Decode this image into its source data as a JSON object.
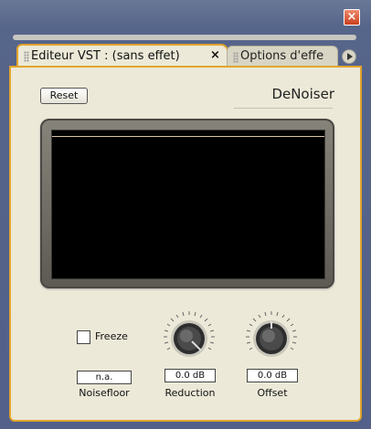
{
  "window": {
    "close_label": "×"
  },
  "tabs": [
    {
      "label": "Editeur VST : (sans effet)",
      "close": "×",
      "active": true
    },
    {
      "label": "Options d'effe",
      "active": false
    }
  ],
  "toolbar": {
    "reset_label": "Reset",
    "plugin_name": "DeNoiser"
  },
  "controls": {
    "freeze": {
      "label": "Freeze",
      "checked": false
    },
    "noisefloor": {
      "label": "Noisefloor",
      "value": "n.a."
    },
    "reduction": {
      "label": "Reduction",
      "value": "0.0 dB"
    },
    "offset": {
      "label": "Offset",
      "value": "0.0 dB"
    }
  },
  "colors": {
    "accent": "#e2a52d",
    "panel": "#ece9d8",
    "title_bar": "#5b6a8c"
  }
}
